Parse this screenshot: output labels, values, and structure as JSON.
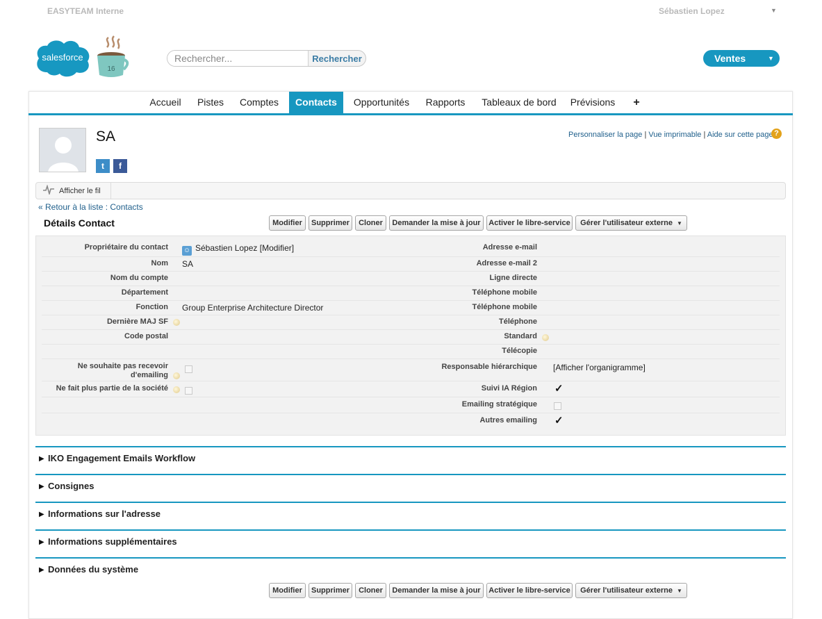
{
  "topbar": {
    "org_name": "EASYTEAM Interne",
    "user_name": "Sébastien Lopez"
  },
  "logo": {
    "brand": "salesforce",
    "release_badge": "16"
  },
  "search": {
    "placeholder": "Rechercher...",
    "button_label": "Rechercher"
  },
  "app_switcher": {
    "label": "Ventes"
  },
  "tabs": [
    {
      "label": "Accueil"
    },
    {
      "label": "Pistes"
    },
    {
      "label": "Comptes"
    },
    {
      "label": "Contacts",
      "active": true
    },
    {
      "label": "Opportunités"
    },
    {
      "label": "Rapports"
    },
    {
      "label": "Tableaux de bord"
    },
    {
      "label": "Prévisions"
    },
    {
      "label": "+"
    }
  ],
  "profile": {
    "name": "SA",
    "twitter_glyph": "t",
    "facebook_glyph": "f"
  },
  "page_links": {
    "customize": "Personnaliser la page",
    "printable": "Vue imprimable",
    "help": "Aide sur cette page",
    "separator": "|",
    "help_icon": "?"
  },
  "feed": {
    "label": "Afficher le fil"
  },
  "breadcrumb": {
    "prefix": "« Retour à la liste : ",
    "link": "Contacts"
  },
  "details": {
    "title": "Détails Contact",
    "buttons": {
      "edit": "Modifier",
      "delete": "Supprimer",
      "clone": "Cloner",
      "request_update": "Demander la mise à jour",
      "enable_self_service": "Activer le libre-service",
      "manage_external_user": "Gérer l'utilisateur externe"
    },
    "left": {
      "owner_label": "Propriétaire du contact",
      "owner_value": "Sébastien Lopez",
      "owner_link": "[Modifier]",
      "name_label": "Nom",
      "name_value": "SA",
      "account_label": "Nom du compte",
      "department_label": "Département",
      "title_label": "Fonction",
      "title_value": "Group Enterprise Architecture Director",
      "last_update_label": "Dernière MAJ SF",
      "zip_label": "Code postal",
      "opt_out_label_1": "Ne souhaite pas recevoir",
      "opt_out_label_2": "d'emailing",
      "left_company_label": "Ne fait plus partie de la société"
    },
    "right": {
      "email_label": "Adresse e-mail",
      "email2_label": "Adresse e-mail 2",
      "direct_line_label": "Ligne directe",
      "mobile_label": "Téléphone mobile",
      "mobile2_label": "Téléphone mobile",
      "phone_label": "Téléphone",
      "switchboard_label": "Standard",
      "fax_label": "Télécopie",
      "manager_label": "Responsable hiérarchique",
      "manager_value": "[Afficher l'organigramme]",
      "ia_region_label": "Suivi IA Région",
      "strategic_emailing_label": "Emailing stratégique",
      "other_emailing_label": "Autres emailing",
      "checkmark": "✓"
    }
  },
  "related_sections": [
    {
      "title": "IKO Engagement Emails Workflow"
    },
    {
      "title": "Consignes"
    },
    {
      "title": "Informations sur l'adresse"
    },
    {
      "title": "Informations supplémentaires"
    },
    {
      "title": "Données du système"
    }
  ]
}
